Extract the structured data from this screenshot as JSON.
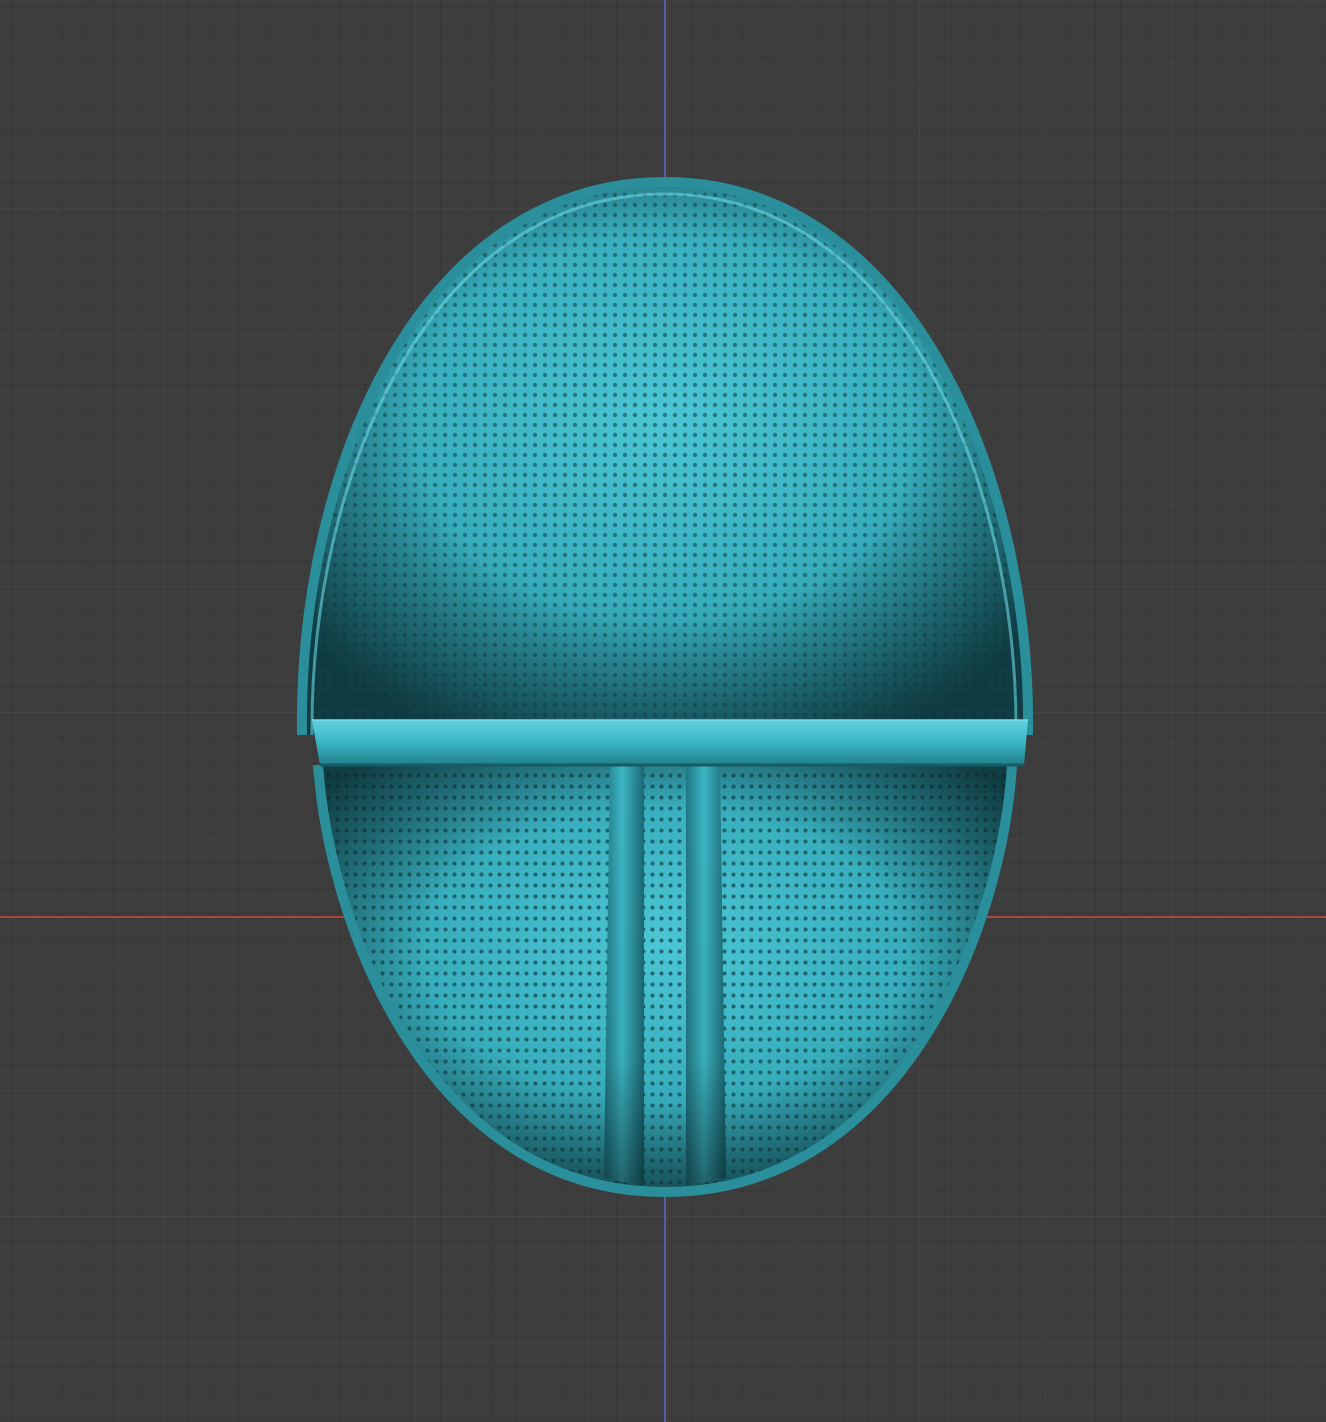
{
  "app": {
    "window_title": ""
  },
  "viewport": {
    "background_color": "#3d3d3d",
    "grid_visible": true,
    "axes": [
      {
        "name": "x-axis",
        "color": "#a8473d"
      },
      {
        "name": "y-axis",
        "color": "#5b5ba8"
      }
    ]
  },
  "object": {
    "type": "mask",
    "material_color": "#3cb6c4",
    "shading": "solid",
    "features": [
      "perforated-mesh",
      "forehead-band",
      "vertical-bars"
    ]
  }
}
